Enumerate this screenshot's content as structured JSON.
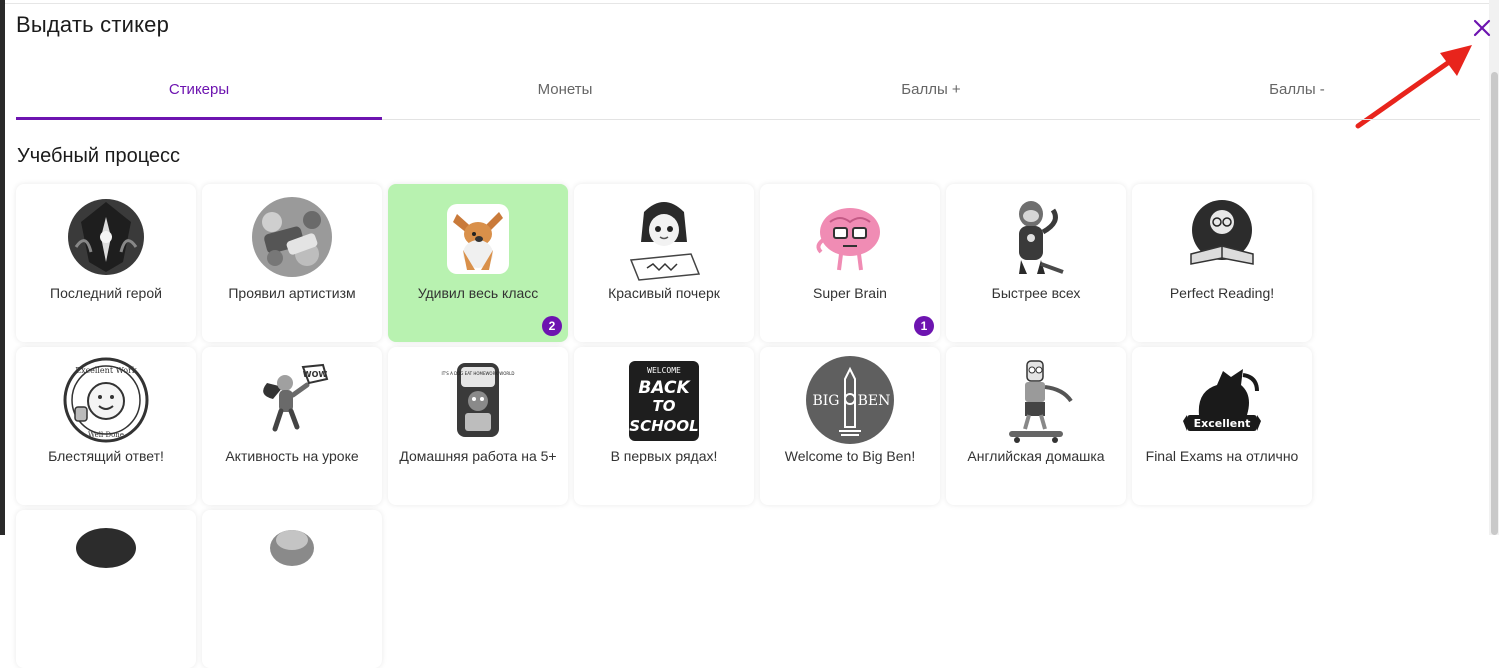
{
  "dialog": {
    "title": "Выдать стикер",
    "close_icon": "close-icon"
  },
  "tabs": [
    {
      "label": "Стикеры",
      "active": true
    },
    {
      "label": "Монеты"
    },
    {
      "label": "Баллы +"
    },
    {
      "label": "Баллы -"
    }
  ],
  "section": {
    "title": "Учебный процесс"
  },
  "stickers": [
    {
      "label": "Последний герой",
      "icon": "hero-sticker"
    },
    {
      "label": "Проявил артистизм",
      "icon": "make-pop-sticker"
    },
    {
      "label": "Удивил весь класс",
      "icon": "dabbing-dog-sticker",
      "selected": true,
      "count": "2"
    },
    {
      "label": "Красивый почерк",
      "icon": "writing-girl-sticker"
    },
    {
      "label": "Super Brain",
      "icon": "brain-sticker",
      "count": "1"
    },
    {
      "label": "Быстрее всех",
      "icon": "sloth-sticker"
    },
    {
      "label": "Perfect Reading!",
      "icon": "reading-sticker"
    },
    {
      "label": "Блестящий ответ!",
      "icon": "excellent-work-sticker",
      "text": [
        "Excellent Work",
        "Well Done"
      ]
    },
    {
      "label": "Активность на уроке",
      "icon": "superhero-sticker",
      "text": [
        "WOW"
      ]
    },
    {
      "label": "Домашняя работа на 5+",
      "icon": "homework-sticker",
      "text": [
        "IT'S A DOG EAT HOMEWORK WORLD"
      ]
    },
    {
      "label": "В первых рядах!",
      "icon": "back-to-school-sticker",
      "text": [
        "WELCOME",
        "BACK",
        "TO",
        "SCHOOL"
      ]
    },
    {
      "label": "Welcome to Big Ben!",
      "icon": "big-ben-sticker",
      "text": [
        "BIG",
        "BEN"
      ]
    },
    {
      "label": "Английская домашка",
      "icon": "skater-sticker"
    },
    {
      "label": "Final Exams на отлично",
      "icon": "excellent-horse-sticker",
      "text": [
        "Excellent"
      ]
    },
    {
      "label": "",
      "icon": "partial-sticker"
    },
    {
      "label": "",
      "icon": "partial-sticker"
    }
  ],
  "colors": {
    "accent": "#6d14b0",
    "selected_bg": "#b8f2b0",
    "annotation_arrow": "#e8241c"
  }
}
